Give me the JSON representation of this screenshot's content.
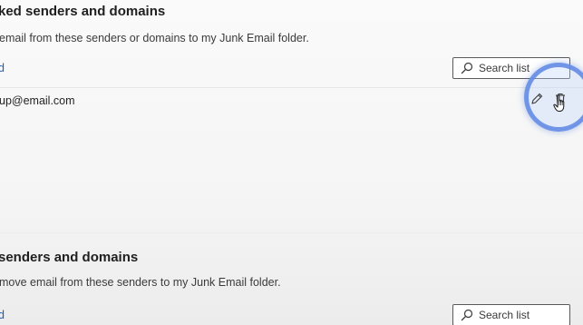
{
  "blocked": {
    "title": "ked senders and domains",
    "description": "email from these senders or domains to my Junk Email folder.",
    "add_label": "d",
    "search_placeholder": "Search list",
    "entries": [
      {
        "email": "up@email.com"
      }
    ]
  },
  "safe": {
    "title": "senders and domains",
    "description": "move email from these senders to my Junk Email folder.",
    "add_label": "d",
    "search_placeholder": "Search list"
  },
  "icons": {
    "search": "search-icon",
    "edit": "pencil-icon",
    "delete": "trash-icon",
    "cursor": "hand-pointer-icon"
  },
  "colors": {
    "link": "#1a5fb4",
    "highlight_ring": "#648ce6"
  }
}
